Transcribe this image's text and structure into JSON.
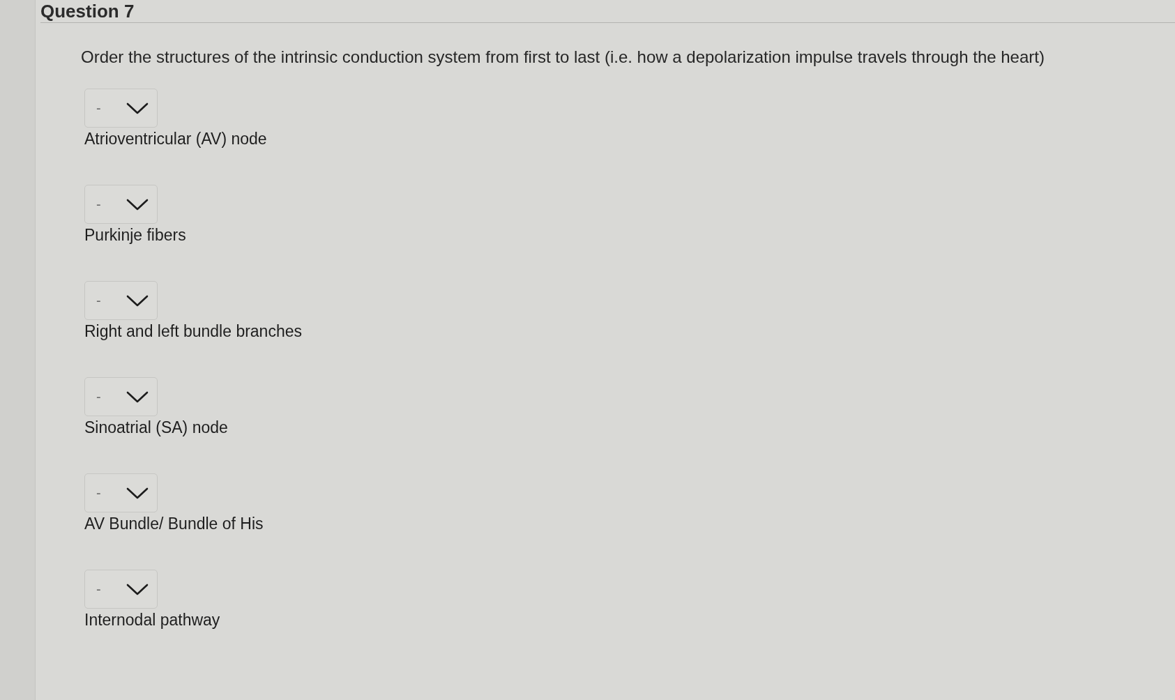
{
  "question": {
    "title": "Question 7",
    "prompt": "Order the structures of the intrinsic conduction system from first to last (i.e. how a depolarization impulse travels through the heart)"
  },
  "items": [
    {
      "value": "-",
      "label": "Atrioventricular (AV) node"
    },
    {
      "value": "-",
      "label": "Purkinje fibers"
    },
    {
      "value": "-",
      "label": "Right and left bundle branches"
    },
    {
      "value": "-",
      "label": "Sinoatrial (SA) node"
    },
    {
      "value": "-",
      "label": "AV Bundle/ Bundle of His"
    },
    {
      "value": "-",
      "label": "Internodal pathway"
    }
  ]
}
